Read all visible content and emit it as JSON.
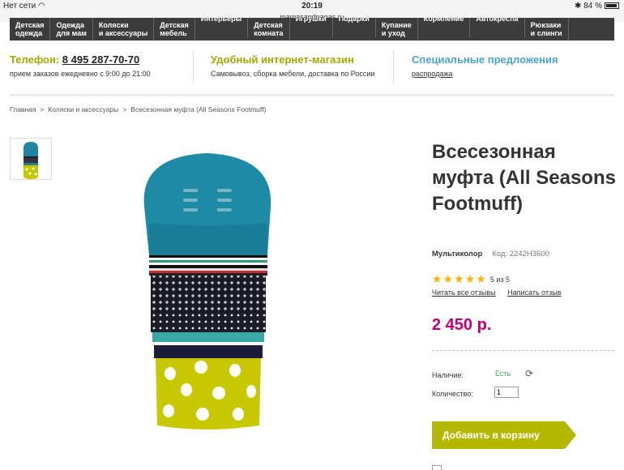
{
  "statusbar": {
    "carrier": "Нет сети",
    "time": "20:19",
    "battery": "84 %",
    "url": "mamasandpapas.ru"
  },
  "nav": {
    "items": [
      {
        "label": "Детская\nодежда",
        "top": false
      },
      {
        "label": "Одежда\nдля мам",
        "top": false
      },
      {
        "label": "Коляски\nи аксессуары",
        "top": false
      },
      {
        "label": "Детская\nмебель",
        "top": false
      },
      {
        "label": "Интерьеры",
        "top": true
      },
      {
        "label": "Детская\nкомната",
        "top": false
      },
      {
        "label": "Игрушки",
        "top": true
      },
      {
        "label": "Подарки",
        "top": true
      },
      {
        "label": "Купание\nи уход",
        "top": false
      },
      {
        "label": "Кормление",
        "top": true
      },
      {
        "label": "Автокресла",
        "top": true
      },
      {
        "label": "Рюкзаки\nи слинги",
        "top": false
      }
    ]
  },
  "info": {
    "phone_prefix": "Телефон: ",
    "phone": "8 495 287-70-70",
    "phone_sub": "прием заказов ежедневно с 9:00 до 21:00",
    "store_title": "Удобный интернет-магазин",
    "store_sub": "Самовывоз, сборка мебели, доставка по России",
    "special_title": "Специальные предложения",
    "special_sub": "распродажа"
  },
  "breadcrumb": {
    "home": "Главная",
    "category": "Коляски и аксессуары",
    "current": "Всесезонная муфта (All Seasons Footmuff)",
    "separator": ">"
  },
  "product": {
    "title": "Всесезонная муфта (All Seasons Footmuff)",
    "color": "Мультиколор",
    "code": "Код: 2242H3600",
    "rating_value": 5,
    "rating_text": "5 из 5",
    "read_reviews": "Читать все отзывы",
    "write_review": "Написать отзыв",
    "price": "2 450 р.",
    "availability_label": "Наличие:",
    "availability_value": "Есть",
    "quantity_label": "Количество:",
    "quantity_value": "1",
    "add_to_cart": "Добавить в корзину"
  },
  "colors": {
    "accent_green": "#b5b800",
    "price": "#c0007a",
    "nav_bg": "#3c3c3c",
    "special": "#4aa3c8"
  },
  "icons": {
    "wifi": "wifi-icon",
    "bluetooth": "bluetooth-icon",
    "battery": "battery-icon",
    "star": "star-icon",
    "refresh": "refresh-icon"
  }
}
